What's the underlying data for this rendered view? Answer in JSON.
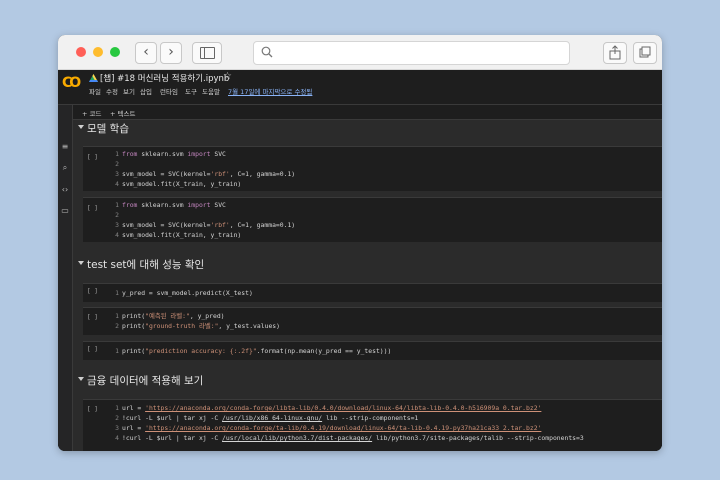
{
  "notebook": {
    "title": "[챕] #18 머신러닝 적용하기.ipynb",
    "star": "☆",
    "menus": [
      "파일",
      "수정",
      "보기",
      "삽입",
      "런타임",
      "도구",
      "도움말"
    ],
    "last_edit": "7월 17일에 마지막으로 수정됨"
  },
  "toolbar": {
    "add_code": "+ 코드",
    "add_text": "+ 텍스트"
  },
  "cells": {
    "run_label": "[ ]",
    "c1": {
      "n1": "1",
      "t1a": "from",
      "t1b": " sklearn.svm ",
      "t1c": "import",
      "t1d": " SVC",
      "n2": "2",
      "n3": "3",
      "t3a": "svm_model = SVC(kernel=",
      "t3b": "'rbf'",
      "t3c": ", C=1, gamma=0.1)",
      "n4": "4",
      "t4": "svm_model.fit(X_train, y_train)"
    },
    "c2": {
      "n1": "1",
      "t1a": "from",
      "t1b": " sklearn.svm ",
      "t1c": "import",
      "t1d": " SVC",
      "n2": "2",
      "n3": "3",
      "t3a": "svm_model = SVC(kernel=",
      "t3b": "'rbf'",
      "t3c": ", C=1, gamma=0.1)",
      "n4": "4",
      "t4": "svm_model.fit(X_train, y_train)"
    },
    "c3": {
      "n1": "1",
      "t1": "y_pred = svm_model.predict(X_test)"
    },
    "c4": {
      "n1": "1",
      "t1a": "print(",
      "t1b": "\"예측된 라벨:\"",
      "t1c": ", y_pred)",
      "n2": "2",
      "t2a": "print(",
      "t2b": "\"ground-truth 라벨:\"",
      "t2c": ", y_test.values)"
    },
    "c5": {
      "n1": "1",
      "t1a": "print(",
      "t1b": "\"prediction accuracy: {:.2f}\"",
      "t1c": ".format(np.mean(y_pred == y_test)))"
    },
    "c6": {
      "n1": "1",
      "t1a": "url = ",
      "t1b": "'https://anaconda.org/conda-forge/libta-lib/0.4.0/download/linux-64/libta-lib-0.4.0-h516909a_0.tar.bz2'",
      "n2": "2",
      "t2a": "!curl -L $url | tar xj -C ",
      "t2b": "/usr/lib/x86_64-linux-gnu/",
      "t2c": " lib --strip-components=1",
      "n3": "3",
      "t3a": "url = ",
      "t3b": "'https://anaconda.org/conda-forge/ta-lib/0.4.19/download/linux-64/ta-lib-0.4.19-py37ha21ca33_2.tar.bz2'",
      "n4": "4",
      "t4a": "!curl -L $url | tar xj -C ",
      "t4b": "/usr/local/lib/python3.7/dist-packages/",
      "t4c": " lib/python3.7/site-packages/talib --strip-components=3"
    }
  },
  "sections": {
    "s1": "모델 학습",
    "s2": "test set에 대해 성능 확인",
    "s3": "금융 데이터에 적용해 보기"
  },
  "colors": {
    "background": "#b3c9e3",
    "accent_orange": "#f9ab00",
    "link_blue": "#8ab4f8",
    "keyword": "#c586c0",
    "string": "#ce9178"
  },
  "icons": [
    "colab-logo-icon",
    "drive-icon",
    "star-icon",
    "menu-icon",
    "search-icon",
    "code-icon",
    "folder-icon",
    "terminal-icon",
    "share-icon",
    "new-tab-icon"
  ]
}
